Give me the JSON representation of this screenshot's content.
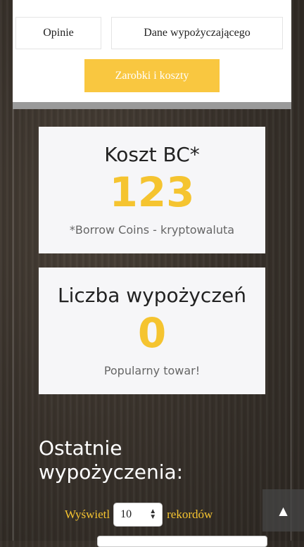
{
  "tabs": {
    "opinie": "Opinie",
    "dane": "Dane wypożyczającego"
  },
  "earnings_button": "Zarobki i koszty",
  "cost_card": {
    "title": "Koszt BC*",
    "value": "123",
    "note": "*Borrow Coins - kryptowaluta"
  },
  "rentals_card": {
    "title": "Liczba wypożyczeń",
    "value": "0",
    "note": "Popularny towar!"
  },
  "recent": {
    "title": "Ostatnie wypożyczenia:",
    "show_label": "Wyświetl",
    "page_size": "10",
    "records_label": "rekordów"
  },
  "colors": {
    "accent": "#f9c740",
    "card_bg": "#f6f6f8",
    "divider": "#9a9a9a"
  },
  "icons": {
    "scroll_top": "caret-up-icon",
    "select": "sort-arrows-icon"
  }
}
